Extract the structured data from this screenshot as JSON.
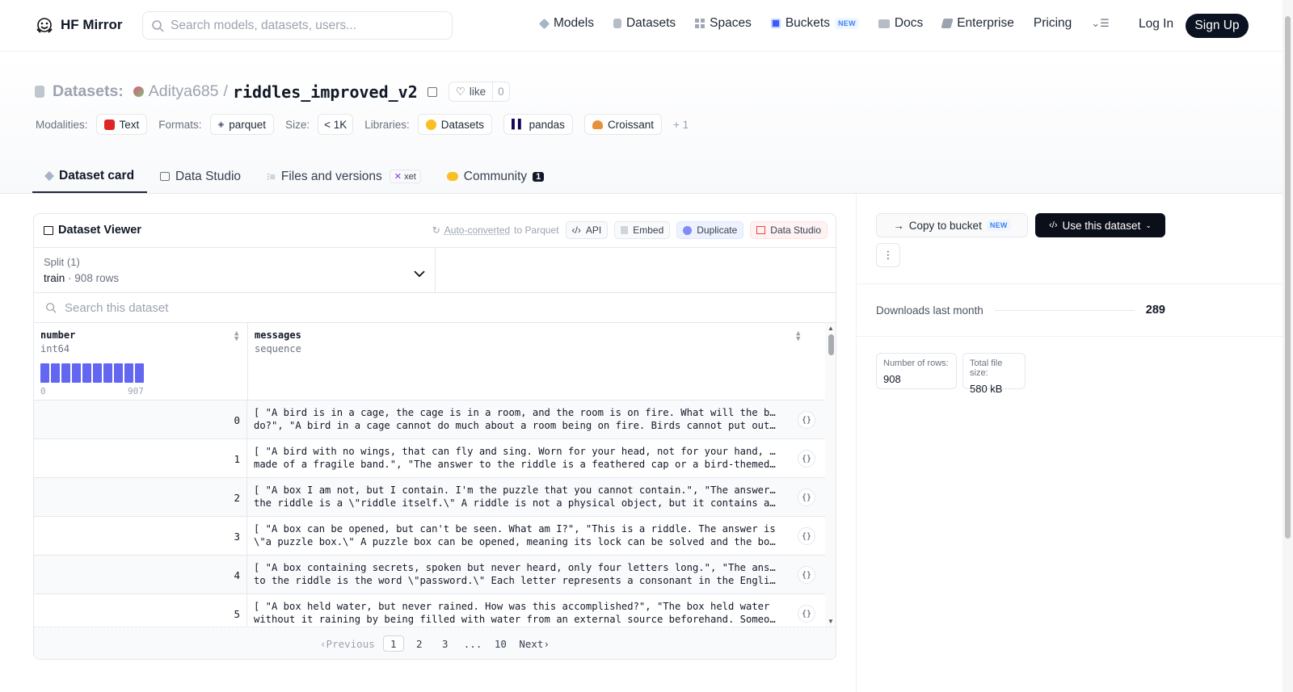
{
  "nav": {
    "brand": "HF Mirror",
    "search_placeholder": "Search models, datasets, users...",
    "items": [
      {
        "label": "Models",
        "icon": "model-cube-icon"
      },
      {
        "label": "Datasets",
        "icon": "dataset-icon"
      },
      {
        "label": "Spaces",
        "icon": "spaces-grid-icon"
      },
      {
        "label": "Buckets",
        "icon": "bucket-icon",
        "badge": "NEW"
      },
      {
        "label": "Docs",
        "icon": "book-icon"
      },
      {
        "label": "Enterprise",
        "icon": "enterprise-icon"
      },
      {
        "label": "Pricing"
      }
    ],
    "login": "Log In",
    "signup": "Sign Up"
  },
  "header": {
    "section": "Datasets:",
    "owner": "Aditya685",
    "separator": "/",
    "name": "riddles_improved_v2",
    "like_label": "like",
    "like_count": "0",
    "meta": {
      "modalities_key": "Modalities:",
      "modality": "Text",
      "formats_key": "Formats:",
      "format": "parquet",
      "size_key": "Size:",
      "size": "< 1K",
      "libraries_key": "Libraries:",
      "libraries": [
        "Datasets",
        "pandas",
        "Croissant"
      ],
      "more_libs": "+ 1"
    }
  },
  "tabs": [
    {
      "label": "Dataset card",
      "active": true
    },
    {
      "label": "Data Studio"
    },
    {
      "label": "Files and versions",
      "badge": "xet"
    },
    {
      "label": "Community",
      "count": "1"
    }
  ],
  "viewer": {
    "title": "Dataset Viewer",
    "auto_converted": "Auto-converted",
    "to_parquet": "to Parquet",
    "btn_api": "API",
    "btn_embed": "Embed",
    "btn_duplicate": "Duplicate",
    "btn_studio": "Data Studio",
    "split_label": "Split (1)",
    "split_name": "train",
    "split_rows": "908 rows",
    "search_placeholder": "Search this dataset",
    "columns": [
      {
        "name": "number",
        "type": "int64",
        "min": "0",
        "max": "907"
      },
      {
        "name": "messages",
        "type": "sequence"
      }
    ],
    "histogram": [
      1,
      1,
      1,
      1,
      1,
      1,
      1,
      1,
      1,
      1
    ],
    "rows": [
      {
        "number": "0",
        "l1": "[ \"A bird is in a cage, the cage is in a room, and the room is on fire. What will the bird",
        "l2": "do?\", \"A bird in a cage cannot do much about a room being on fire. Birds cannot put out…"
      },
      {
        "number": "1",
        "l1": "[ \"A bird with no wings, that can fly and sing. Worn for your head, not for your hand, it's",
        "l2": "made of a fragile band.\", \"The answer to the riddle is a feathered cap or a bird-themed…"
      },
      {
        "number": "2",
        "l1": "[ \"A box I am not, but I contain. I'm the puzzle that you cannot contain.\", \"The answer to",
        "l2": "the riddle is a \\\"riddle itself.\\\" A riddle is not a physical object, but it contains a…"
      },
      {
        "number": "3",
        "l1": "[ \"A box can be opened, but can't be seen. What am I?\", \"This is a riddle. The answer is",
        "l2": "\\\"a puzzle box.\\\" A puzzle box can be opened, meaning its lock can be solved and the box…"
      },
      {
        "number": "4",
        "l1": "[ \"A box containing secrets, spoken but never heard, only four letters long.\", \"The answer",
        "l2": "to the riddle is the word \\\"password.\\\" Each letter represents a consonant in the English…"
      },
      {
        "number": "5",
        "l1": "[ \"A box held water, but never rained. How was this accomplished?\", \"The box held water",
        "l2": "without it raining by being filled with water from an external source beforehand. Someone…"
      }
    ],
    "pager": {
      "prev": "Previous",
      "pages": [
        "1",
        "2",
        "3",
        "...",
        "10"
      ],
      "current": "1",
      "next": "Next"
    }
  },
  "sidebar": {
    "copy_label": "Copy to bucket",
    "copy_badge": "NEW",
    "use_label": "Use this dataset",
    "downloads_label": "Downloads last month",
    "downloads_value": "289",
    "rows_label": "Number of rows:",
    "rows_value": "908",
    "filesize_label": "Total file size:",
    "filesize_value": "580 kB"
  }
}
